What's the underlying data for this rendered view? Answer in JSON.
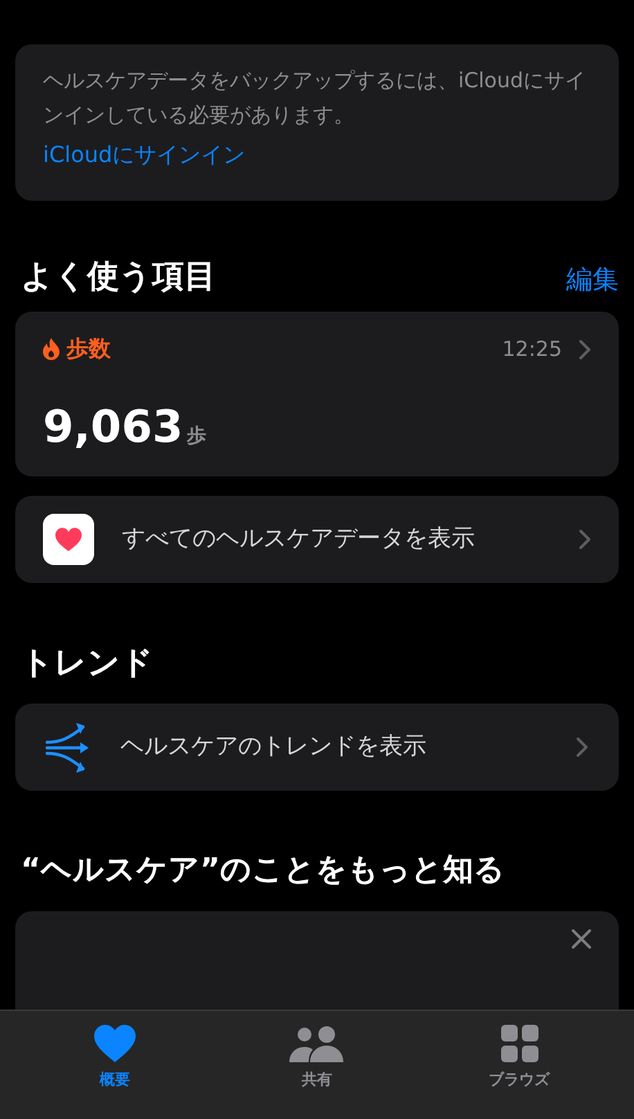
{
  "backup_notice": {
    "message": "ヘルスケアデータをバックアップするには、iCloudにサインインしている必要があります。",
    "link": "iCloudにサインイン"
  },
  "favorites": {
    "title": "よく使う項目",
    "edit": "編集",
    "metric": {
      "label": "歩数",
      "time": "12:25",
      "value": "9,063",
      "unit": "歩"
    },
    "all_data": "すべてのヘルスケアデータを表示"
  },
  "trends": {
    "title": "トレンド",
    "row": "ヘルスケアのトレンドを表示"
  },
  "learn": {
    "title": "“ヘルスケア”のことをもっと知る"
  },
  "tabs": [
    {
      "label": "概要",
      "kind": "heart",
      "selected": true
    },
    {
      "label": "共有",
      "kind": "people",
      "selected": false
    },
    {
      "label": "ブラウズ",
      "kind": "grid",
      "selected": false
    }
  ]
}
